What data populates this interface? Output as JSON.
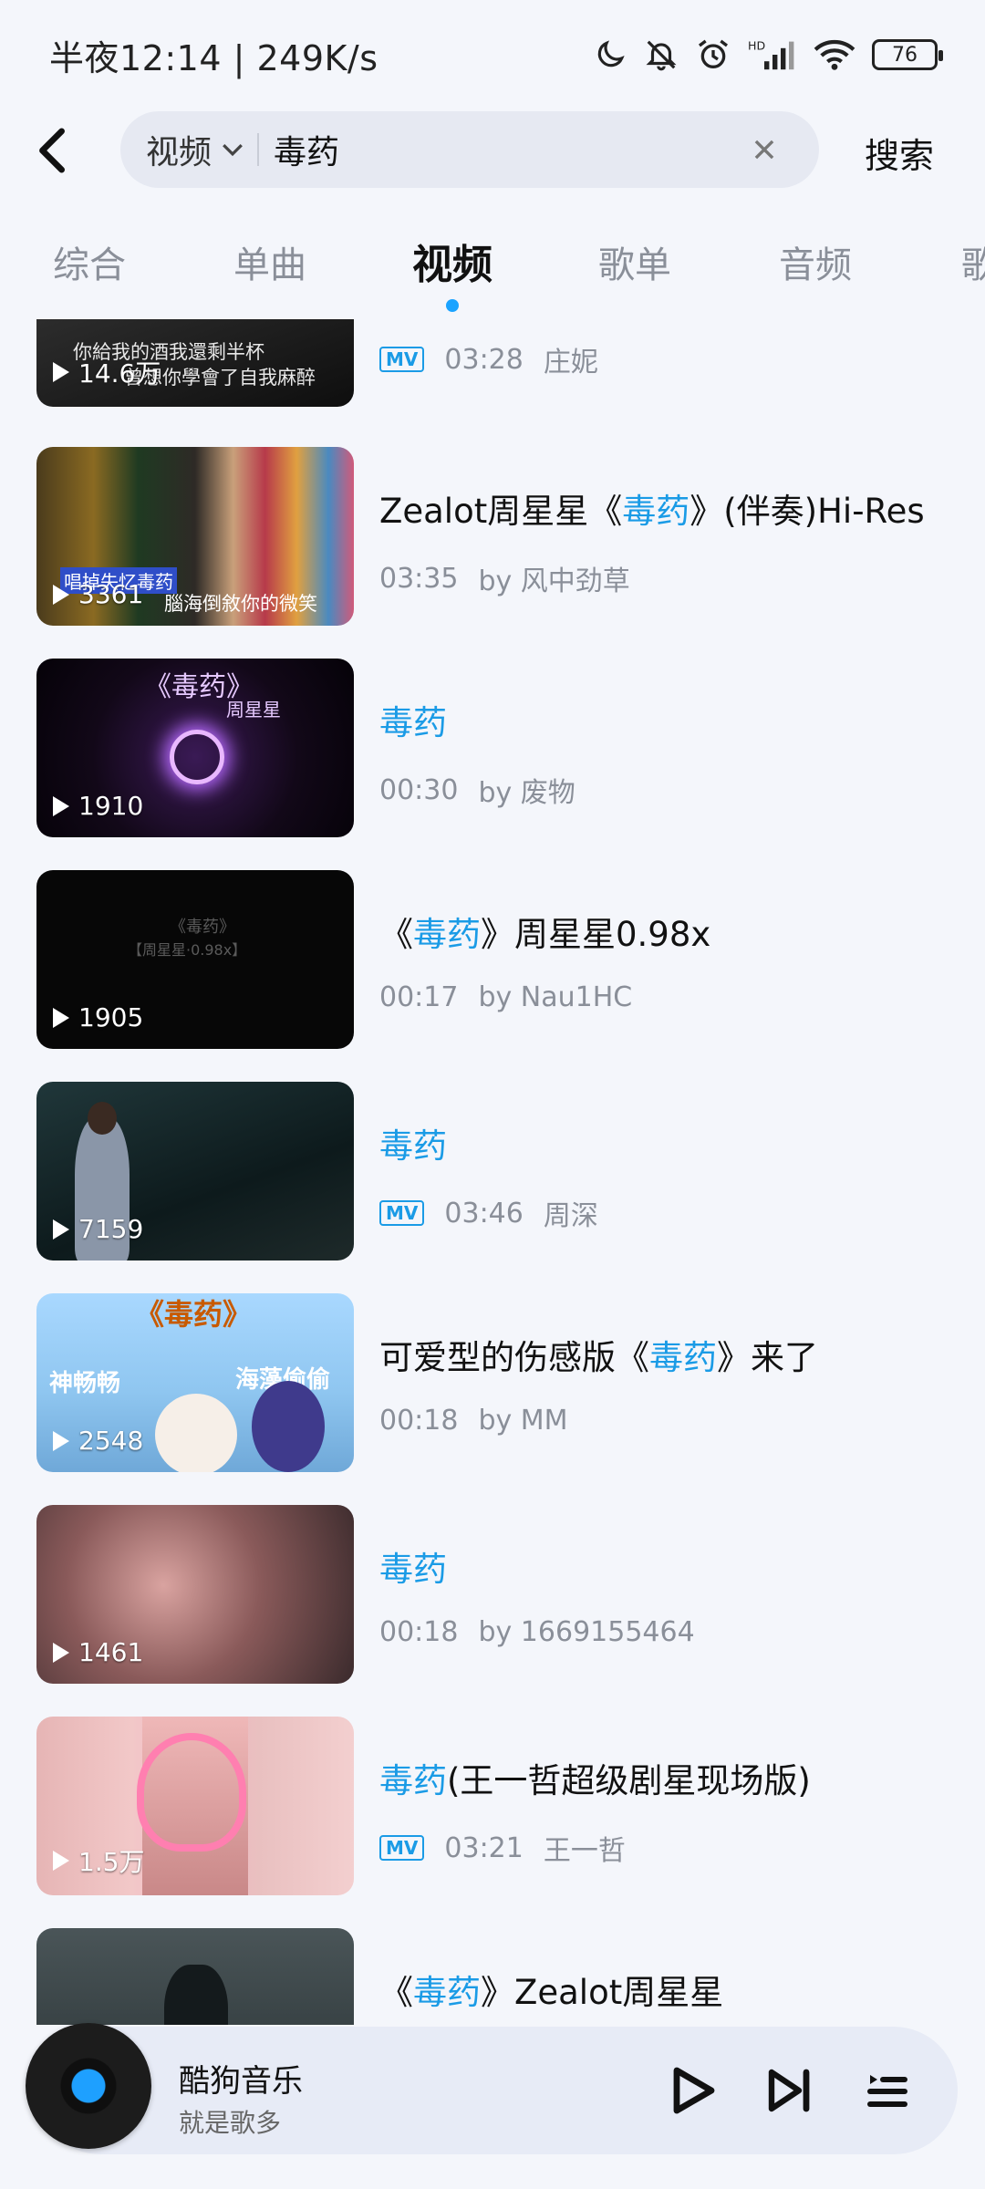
{
  "status_bar": {
    "left_text": "半夜12:14 | 249K/s",
    "battery": "76",
    "icons": [
      "moon-icon",
      "bell-off-icon",
      "alarm-icon",
      "hd-signal-icon",
      "wifi-icon",
      "battery-icon"
    ]
  },
  "search": {
    "scope": "视频",
    "query": "毒药",
    "submit_label": "搜索"
  },
  "tabs": [
    {
      "label": "综合"
    },
    {
      "label": "单曲"
    },
    {
      "label": "视频",
      "active": true
    },
    {
      "label": "歌单"
    },
    {
      "label": "音频"
    },
    {
      "label": "歌"
    }
  ],
  "videos": [
    {
      "count": "14.6万",
      "title_pre": "",
      "title_hl": "",
      "title_post": "",
      "mv": true,
      "duration": "03:28",
      "author": "庄妮"
    },
    {
      "count": "3361",
      "title_pre": "Zealot周星星《",
      "title_hl": "毒药",
      "title_post": "》(伴奏)Hi-Res",
      "mv": false,
      "duration": "03:35",
      "author": "by 风中劲草"
    },
    {
      "count": "1910",
      "title_pre": "",
      "title_hl": "毒药",
      "title_post": "",
      "mv": false,
      "duration": "00:30",
      "author": "by 废物"
    },
    {
      "count": "1905",
      "title_pre": "《",
      "title_hl": "毒药",
      "title_post": "》周星星0.98x",
      "mv": false,
      "duration": "00:17",
      "author": "by Nau1HC"
    },
    {
      "count": "7159",
      "title_pre": "",
      "title_hl": "毒药",
      "title_post": "",
      "mv": true,
      "duration": "03:46",
      "author": "周深"
    },
    {
      "count": "2548",
      "title_pre": "可爱型的伤感版《",
      "title_hl": "毒药",
      "title_post": "》来了",
      "mv": false,
      "duration": "00:18",
      "author": "by MM"
    },
    {
      "count": "1461",
      "title_pre": "",
      "title_hl": "毒药",
      "title_post": "",
      "mv": false,
      "duration": "00:18",
      "author": "by 1669155464"
    },
    {
      "count": "1.5万",
      "title_pre": "",
      "title_hl": "毒药",
      "title_post": "(王一哲超级剧星现场版)",
      "mv": true,
      "duration": "03:21",
      "author": "王一哲"
    },
    {
      "count": "",
      "title_pre": "《",
      "title_hl": "毒药",
      "title_post": "》Zealot周星星",
      "mv": false,
      "duration": "",
      "author": ""
    }
  ],
  "thumb_captions": {
    "v0": "你給我的酒我還剩半杯",
    "v0b": "曾想你學會了自我麻醉",
    "v1": "腦海倒敘你的微笑",
    "v1b": "唱掉失忆毒药",
    "v2": "《毒药》",
    "v2b": "周星星",
    "v3": "《毒药》",
    "v3b": "【周星星·0.98x】",
    "v5": "《毒药》",
    "v5b": "神畅畅",
    "v5c": "海藻偷偷"
  },
  "mv_label": "MV",
  "player": {
    "title": "酷狗音乐",
    "subtitle": "就是歌多"
  },
  "colors": {
    "accent": "#1a9be6",
    "background": "#f4f6fb"
  }
}
